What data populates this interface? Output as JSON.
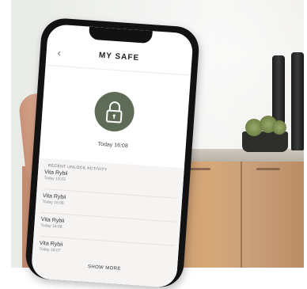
{
  "header": {
    "title": "MY SAFE",
    "back_icon": "chevron-left-icon"
  },
  "lock": {
    "icon": "lock-icon",
    "time": "Today 16:08",
    "color": "#5e6b57"
  },
  "activity": {
    "section_title": "RECENT UNLOCK ACTIVITY",
    "entries": [
      {
        "name": "Vita Rybii",
        "time": "Today 16:03"
      },
      {
        "name": "Vita Rybii",
        "time": "Today 16:08"
      },
      {
        "name": "Vita Rybii",
        "time": "Today 16:08"
      },
      {
        "name": "Vita Rybii",
        "time": "Today 16:07"
      }
    ],
    "show_more": "SHOW MORE"
  }
}
